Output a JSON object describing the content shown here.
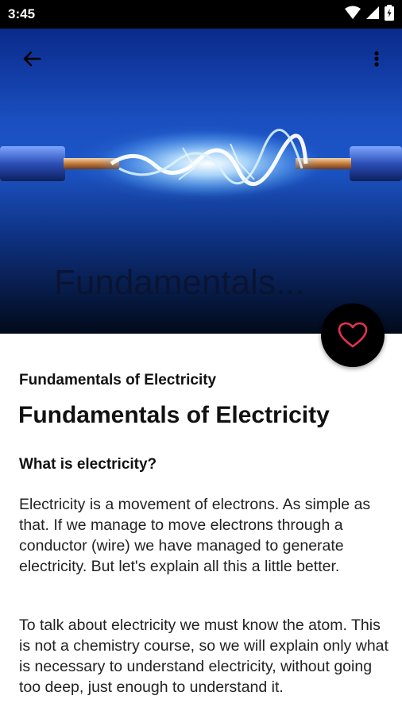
{
  "status_bar": {
    "time": "3:45"
  },
  "header": {
    "collapsed_title": "Fundamentals..."
  },
  "article": {
    "subtitle": "Fundamentals of Electricity",
    "title": "Fundamentals of Electricity",
    "section_heading": "What is electricity?",
    "paragraphs": [
      "Electricity is a movement of electrons. As simple as that. If we manage to move electrons through a conductor (wire) we have managed to generate electricity. But let's explain all this a little better.",
      "To talk about electricity we must know the atom. This is not a chemistry course, so we will explain only what is necessary to understand electricity, without going too deep, just enough to understand it."
    ]
  },
  "icons": {
    "back": "arrow-back-icon",
    "more": "more-vert-icon",
    "favorite": "heart-outline-icon"
  },
  "colors": {
    "fab_background": "#000000",
    "heart": "#e3344f",
    "header_blue": "#1c55c8"
  }
}
